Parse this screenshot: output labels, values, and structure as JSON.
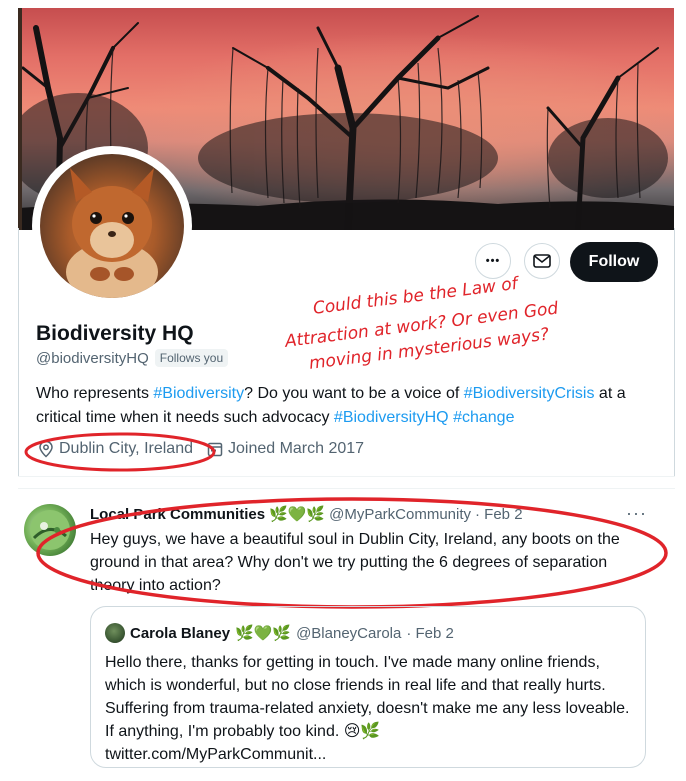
{
  "profile": {
    "name": "Biodiversity HQ",
    "handle": "@biodiversityHQ",
    "follows_you": "Follows you",
    "bio_parts": {
      "p1": "Who represents ",
      "tag1": "#Biodiversity",
      "p2": "? Do you want to be a voice of ",
      "tag2": "#BiodiversityCrisis",
      "p3": " at a critical time when it needs such advocacy ",
      "tag3": "#BiodiversityHQ",
      "p4": " ",
      "tag4": "#change"
    },
    "location": "Dublin City, Ireland",
    "joined": "Joined March 2017",
    "follow_label": "Follow",
    "more_label": "•••"
  },
  "annotation": {
    "line1": "Could this be the Law of",
    "line2": "Attraction at work? Or even God",
    "line3": "moving in mysterious ways?"
  },
  "tweet": {
    "name": "Local Park Communities",
    "emoji": "🌿💚🌿",
    "handle": "@MyParkCommunity",
    "date": "· Feb 2",
    "more": "···",
    "text": "Hey guys, we have a beautiful soul in Dublin City, Ireland, any boots on the ground in that area? Why don't we try putting the 6 degrees of separation theory into action?"
  },
  "quote": {
    "name": "Carola Blaney",
    "emoji": "🌿💚🌿",
    "handle": "@BlaneyCarola",
    "date": "· Feb 2",
    "text": "Hello there, thanks for getting in touch. I've made many online friends, which is wonderful, but no close friends in real life and that really hurts. Suffering from trauma-related anxiety, doesn't make me any less loveable. If anything, I'm probably too kind. 😢🌿",
    "link": "twitter.com/MyParkCommunit..."
  },
  "colors": {
    "link": "#1d9bf0",
    "annotation": "#e0242a",
    "follow_bg": "#0f1419"
  }
}
